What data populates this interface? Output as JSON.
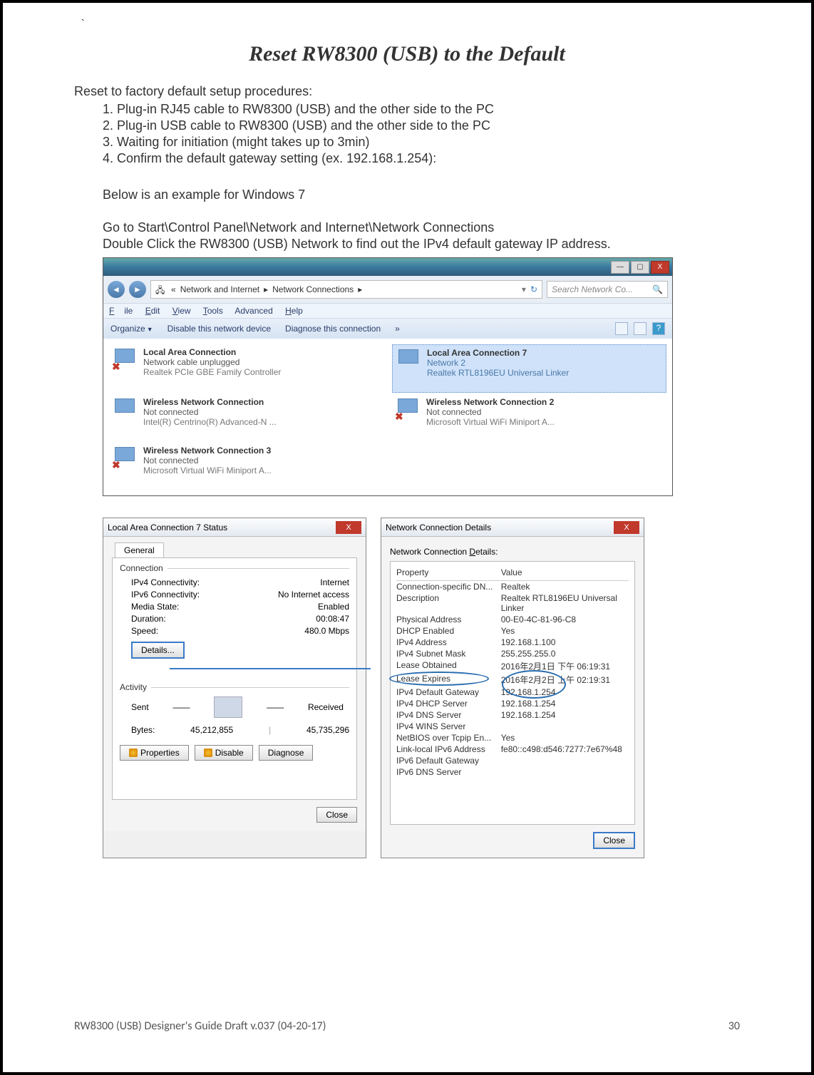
{
  "doc": {
    "tick": "`",
    "title": "Reset RW8300 (USB) to the Default",
    "intro": "Reset to factory default setup procedures:",
    "steps": [
      "Plug-in RJ45 cable to RW8300 (USB) and the other side to the PC",
      "Plug-in USB cable to RW8300 (USB) and the other side to the PC",
      "Waiting for initiation (might takes up to 3min)",
      "Confirm the default gateway setting (ex. 192.168.1.254):"
    ],
    "example_label": "Below is an example for Windows 7",
    "path_line": "Go to Start\\Control Panel\\Network and Internet\\Network Connections",
    "dblclick_line": "Double Click the RW8300 (USB) Network to find out the IPv4 default gateway IP address."
  },
  "ncwin": {
    "breadcrumb_prefix": "«",
    "breadcrumb_a": "Network and Internet",
    "breadcrumb_b": "Network Connections",
    "search_placeholder": "Search Network Co...",
    "menu": {
      "file": "File",
      "edit": "Edit",
      "view": "View",
      "tools": "Tools",
      "advanced": "Advanced",
      "help": "Help"
    },
    "toolbar": {
      "organize": "Organize",
      "disable": "Disable this network device",
      "diagnose": "Diagnose this connection",
      "more": "»"
    },
    "conns": [
      {
        "name": "Local Area Connection",
        "status": "Network cable unplugged",
        "dev": "Realtek PCIe GBE Family Controller",
        "x": true
      },
      {
        "name": "Local Area Connection 7",
        "status": "Network 2",
        "dev": "Realtek RTL8196EU Universal Linker",
        "selected": true
      },
      {
        "name": "Wireless Network Connection",
        "status": "Not connected",
        "dev": "Intel(R) Centrino(R) Advanced-N ...",
        "x": false
      },
      {
        "name": "Wireless Network Connection 2",
        "status": "Not connected",
        "dev": "Microsoft Virtual WiFi Miniport A...",
        "x": true
      },
      {
        "name": "Wireless Network Connection 3",
        "status": "Not connected",
        "dev": "Microsoft Virtual WiFi Miniport A...",
        "x": true
      }
    ]
  },
  "status": {
    "title": "Local Area Connection 7 Status",
    "tab": "General",
    "section1": "Connection",
    "rows": [
      {
        "k": "IPv4 Connectivity:",
        "v": "Internet"
      },
      {
        "k": "IPv6 Connectivity:",
        "v": "No Internet access"
      },
      {
        "k": "Media State:",
        "v": "Enabled"
      },
      {
        "k": "Duration:",
        "v": "00:08:47"
      },
      {
        "k": "Speed:",
        "v": "480.0 Mbps"
      }
    ],
    "details_btn": "Details...",
    "section2": "Activity",
    "sent": "Sent",
    "received": "Received",
    "bytes_label": "Bytes:",
    "bytes_sent": "45,212,855",
    "bytes_recv": "45,735,296",
    "btn_props": "Properties",
    "btn_disable": "Disable",
    "btn_diag": "Diagnose",
    "btn_close": "Close"
  },
  "details": {
    "title": "Network Connection Details",
    "subtitle": "Network Connection Details:",
    "col1": "Property",
    "col2": "Value",
    "rows": [
      {
        "k": "Connection-specific DN...",
        "v": "Realtek"
      },
      {
        "k": "Description",
        "v": "Realtek RTL8196EU Universal Linker"
      },
      {
        "k": "Physical Address",
        "v": "00-E0-4C-81-96-C8"
      },
      {
        "k": "DHCP Enabled",
        "v": "Yes"
      },
      {
        "k": "IPv4 Address",
        "v": "192.168.1.100"
      },
      {
        "k": "IPv4 Subnet Mask",
        "v": "255.255.255.0"
      },
      {
        "k": "Lease Obtained",
        "v": "2016年2月1日 下午 06:19:31"
      },
      {
        "k": "Lease Expires",
        "v": "2016年2月2日 上午 02:19:31"
      },
      {
        "k": "IPv4 Default Gateway",
        "v": "192.168.1.254"
      },
      {
        "k": "IPv4 DHCP Server",
        "v": "192.168.1.254"
      },
      {
        "k": "IPv4 DNS Server",
        "v": "192.168.1.254"
      },
      {
        "k": "IPv4 WINS Server",
        "v": ""
      },
      {
        "k": "NetBIOS over Tcpip En...",
        "v": "Yes"
      },
      {
        "k": "Link-local IPv6 Address",
        "v": "fe80::c498:d546:7277:7e67%48"
      },
      {
        "k": "IPv6 Default Gateway",
        "v": ""
      },
      {
        "k": "IPv6 DNS Server",
        "v": ""
      }
    ],
    "btn_close": "Close"
  },
  "footer": {
    "left": "RW8300 (USB) Designer's Guide Draft v.037 (04-20-17)",
    "right": "30"
  }
}
